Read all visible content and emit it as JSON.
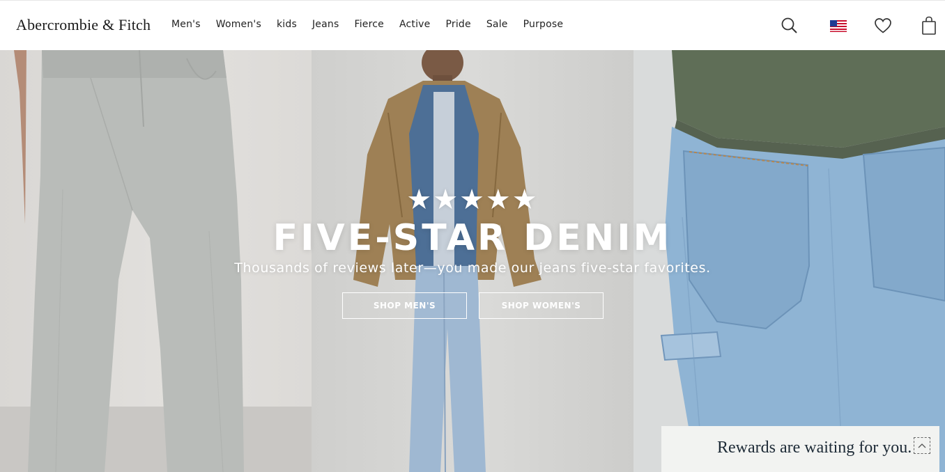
{
  "brand": {
    "logo_text": "Abercrombie & Fitch"
  },
  "nav": {
    "items": [
      {
        "label": "Men's"
      },
      {
        "label": "Women's"
      },
      {
        "label": "kids"
      },
      {
        "label": "Jeans"
      },
      {
        "label": "Fierce"
      },
      {
        "label": "Active"
      },
      {
        "label": "Pride"
      },
      {
        "label": "Sale"
      },
      {
        "label": "Purpose"
      }
    ]
  },
  "utility": {
    "icons": [
      "search-icon",
      "us-flag-icon",
      "heart-icon",
      "shopping-bag-icon"
    ]
  },
  "hero": {
    "rating_stars": "★★★★★",
    "rating_value": 5,
    "headline": "FIVE-STAR DENIM",
    "subtext": "Thousands of reviews later—you made our jeans five-star favorites.",
    "cta_men": "SHOP MEN'S",
    "cta_women": "SHOP WOMEN'S"
  },
  "rewards": {
    "text": "Rewards are waiting for you.",
    "toggle_icon": "chevron-up-icon"
  },
  "colors": {
    "header_bg": "#ffffff",
    "nav_text": "#222222",
    "hero_text": "#ffffff",
    "rewards_bg": "#f2f3f1",
    "rewards_text": "#1d2a36",
    "denim_light": "#8fb4d4",
    "denim_dark": "#5a84aa",
    "sweater_green": "#5f6e57"
  }
}
